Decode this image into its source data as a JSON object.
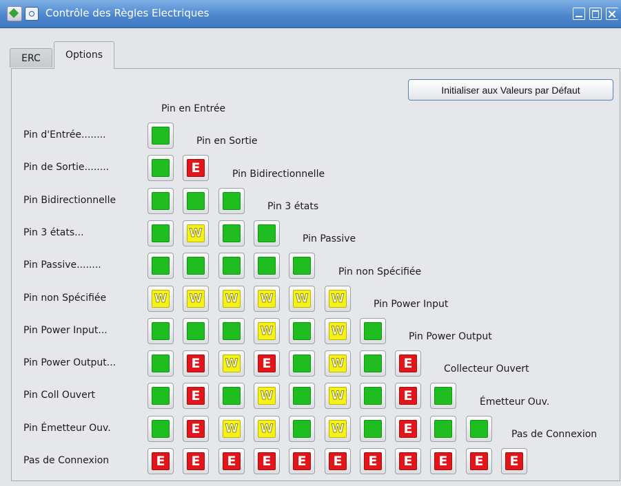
{
  "window": {
    "title": "Contrôle des Règles Electriques"
  },
  "tabs": [
    {
      "label": "ERC",
      "active": false
    },
    {
      "label": "Options",
      "active": true
    }
  ],
  "reset_button": {
    "label": "Initialiser aux Valeurs par Défaut"
  },
  "legend": {
    "ok": "",
    "warn": "W",
    "err": "E"
  },
  "colors": {
    "ok": "#1fbd1f",
    "warn": "#f5f21a",
    "err": "#e2151b",
    "titlebar": "#4d88cf"
  },
  "column_headers": [
    "Pin en Entrée",
    "Pin en Sortie",
    "Pin Bidirectionnelle",
    "Pin 3 états",
    "Pin Passive",
    "Pin non Spécifiée",
    "Pin Power Input",
    "Pin Power Output",
    "Collecteur Ouvert",
    "Émetteur Ouv.",
    "Pas de Connexion"
  ],
  "rows": [
    {
      "label": "Pin d'Entrée........",
      "cells": [
        "ok"
      ]
    },
    {
      "label": "Pin de Sortie........",
      "cells": [
        "ok",
        "err"
      ]
    },
    {
      "label": "Pin Bidirectionnelle",
      "cells": [
        "ok",
        "ok",
        "ok"
      ]
    },
    {
      "label": "Pin 3 états...",
      "cells": [
        "ok",
        "warn",
        "ok",
        "ok"
      ]
    },
    {
      "label": "Pin Passive........",
      "cells": [
        "ok",
        "ok",
        "ok",
        "ok",
        "ok"
      ]
    },
    {
      "label": "Pin non Spécifiée",
      "cells": [
        "warn",
        "warn",
        "warn",
        "warn",
        "warn",
        "warn"
      ]
    },
    {
      "label": "Pin Power Input...",
      "cells": [
        "ok",
        "ok",
        "ok",
        "warn",
        "ok",
        "warn",
        "ok"
      ]
    },
    {
      "label": "Pin Power Output...",
      "cells": [
        "ok",
        "err",
        "warn",
        "err",
        "ok",
        "warn",
        "ok",
        "err"
      ]
    },
    {
      "label": "Pin Coll Ouvert",
      "cells": [
        "ok",
        "err",
        "ok",
        "warn",
        "ok",
        "warn",
        "ok",
        "err",
        "ok"
      ]
    },
    {
      "label": "Pin Émetteur Ouv.",
      "cells": [
        "ok",
        "err",
        "warn",
        "warn",
        "ok",
        "warn",
        "ok",
        "err",
        "ok",
        "ok"
      ]
    },
    {
      "label": "Pas de Connexion",
      "cells": [
        "err",
        "err",
        "err",
        "err",
        "err",
        "err",
        "err",
        "err",
        "err",
        "err",
        "err"
      ]
    }
  ]
}
